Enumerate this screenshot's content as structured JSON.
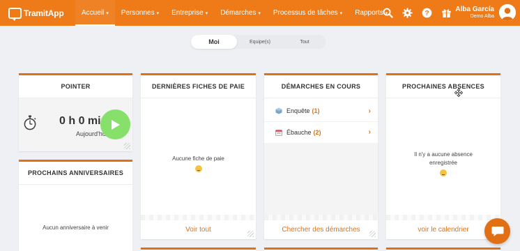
{
  "brand": {
    "name": "TramitApp"
  },
  "nav": {
    "items": [
      {
        "label": "Accueil"
      },
      {
        "label": "Personnes"
      },
      {
        "label": "Entreprise"
      },
      {
        "label": "Démarches"
      },
      {
        "label": "Processus de tâches"
      },
      {
        "label": "Rapports"
      }
    ]
  },
  "top_icons": [
    "search-icon",
    "gear-icon",
    "help-icon",
    "gift-icon"
  ],
  "user": {
    "name": "Alba García",
    "subtitle": "Demo Alba"
  },
  "scope_tabs": [
    {
      "label": "Moi",
      "active": true
    },
    {
      "label": "Equipe(s)",
      "active": false
    },
    {
      "label": "Tout",
      "active": false
    }
  ],
  "cards": {
    "pointer": {
      "title": "POINTER",
      "time": "0 h 0 min",
      "day": "Aujourd'hui"
    },
    "payslips": {
      "title": "DERNIÈRES FICHES DE PAIE",
      "empty": "Aucune fiche de paie",
      "footer": "Voir tout"
    },
    "processes": {
      "title": "DÉMARCHES EN COURS",
      "rows": [
        {
          "label": "Enquête",
          "count": "(1)"
        },
        {
          "label": "Ébauche",
          "count": "(2)"
        }
      ],
      "footer": "Chercher des démarches"
    },
    "absences": {
      "title": "PROCHAINES ABSENCES",
      "empty_line1": "Il n'y a aucune absence",
      "empty_line2": "enregistrée",
      "footer": "voir le calendrier"
    },
    "birthdays": {
      "title": "PROCHAINS ANNIVERSAIRES",
      "empty": "Aucun anniversaire à venir"
    }
  },
  "colors": {
    "accent": "#ee7b18",
    "play": "#86e06a"
  }
}
